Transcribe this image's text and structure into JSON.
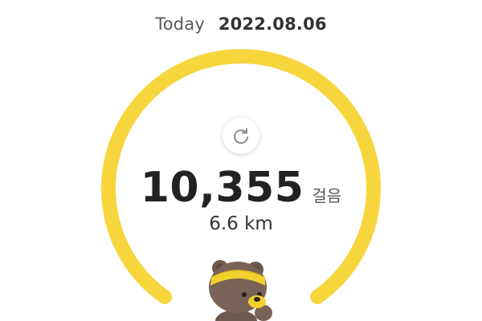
{
  "header": {
    "today_label": "Today",
    "date": "2022.08.06"
  },
  "steps": {
    "value": "10,355",
    "unit": "걸음"
  },
  "distance": "6.6 km",
  "icons": {
    "refresh": "refresh-icon",
    "mascot": "bear-mascot-icon"
  },
  "colors": {
    "ring": "#F7D53D",
    "mascot_body": "#7A6256",
    "headband": "#F2D12E"
  }
}
